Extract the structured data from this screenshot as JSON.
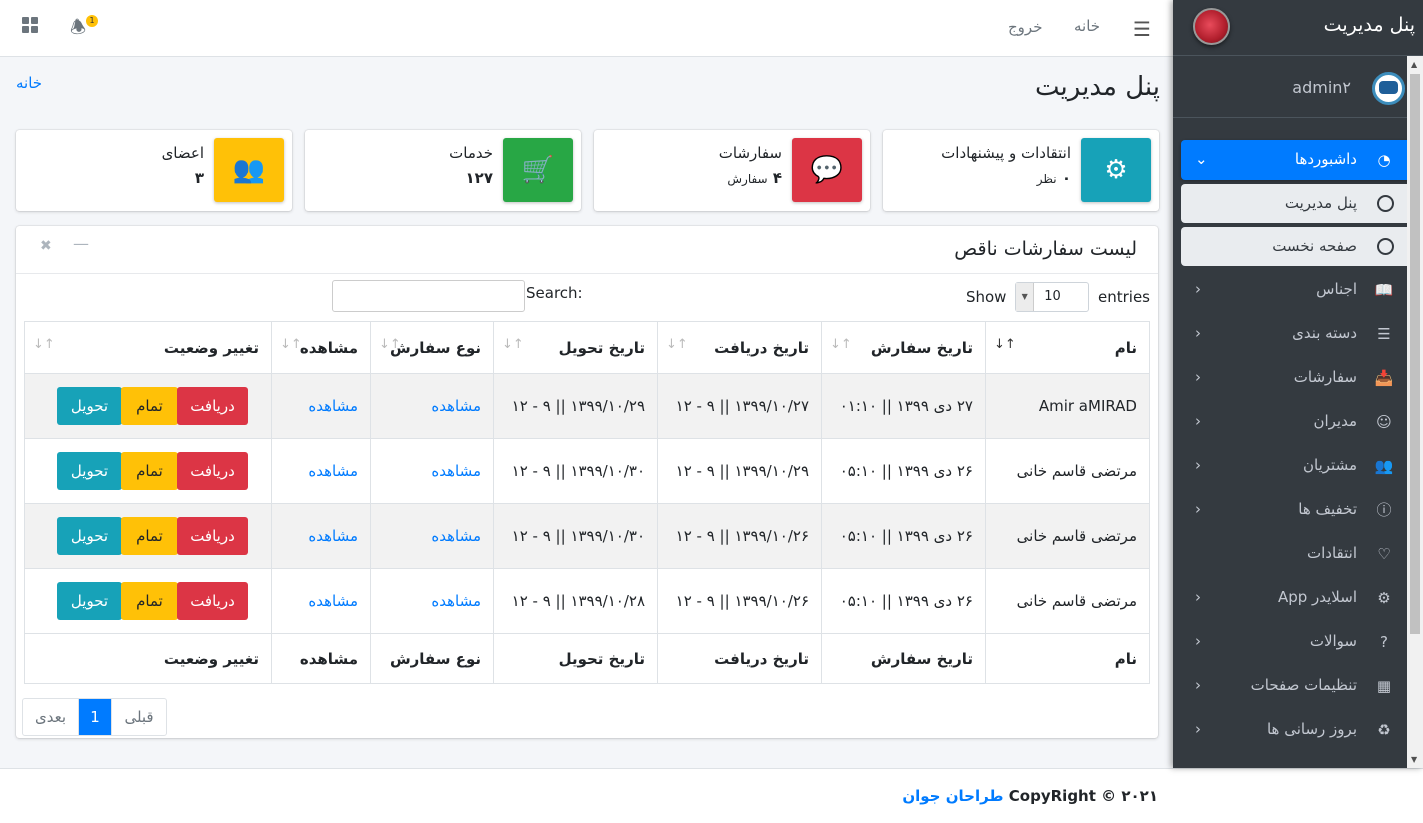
{
  "header": {
    "home": "خانه",
    "logout": "خروج",
    "notif_count": "1"
  },
  "sidebar": {
    "brand": "پنل مدیریت",
    "user": "admin۲",
    "items": [
      {
        "label": "داشبوردها",
        "icon": "dashboard-icon"
      },
      {
        "label": "اجناس",
        "icon": "book-icon"
      },
      {
        "label": "دسته بندی",
        "icon": "list-icon"
      },
      {
        "label": "سفارشات",
        "icon": "inbox-icon"
      },
      {
        "label": "مدیران",
        "icon": "user-circle-icon"
      },
      {
        "label": "مشتریان",
        "icon": "users-icon"
      },
      {
        "label": "تخفیف ها",
        "icon": "info-icon"
      },
      {
        "label": "انتقادات",
        "icon": "heart-icon"
      },
      {
        "label": "اسلایدر App",
        "icon": "sliders-icon"
      },
      {
        "label": "سوالات",
        "icon": "question-icon"
      },
      {
        "label": "تنظیمات صفحات",
        "icon": "settings-icon"
      },
      {
        "label": "بروز رسانی ها",
        "icon": "recycle-icon"
      }
    ],
    "subitems": [
      {
        "label": "پنل مدیریت"
      },
      {
        "label": "صفحه نخست"
      }
    ]
  },
  "page": {
    "breadcrumb": "خانه",
    "title": "پنل مدیریت"
  },
  "info_boxes": [
    {
      "title": "اعضای",
      "value": "۳",
      "sub": "",
      "color": "#ffc107",
      "icon": "users-icon"
    },
    {
      "title": "خدمات",
      "value": "۱۲۷",
      "sub": "",
      "color": "#28a745",
      "icon": "cart-icon"
    },
    {
      "title": "سفارشات",
      "value": "۴",
      "sub": "سفارش",
      "color": "#dc3545",
      "icon": "comment-icon"
    },
    {
      "title": "انتقادات و پیشنهادات",
      "value": "۰",
      "sub": "نظر",
      "color": "#17a2b8",
      "icon": "gear-icon"
    }
  ],
  "card": {
    "title": "لیست سفارشات ناقص",
    "show_label": "Show",
    "entries_label": "entries",
    "page_size": "10",
    "search_label": "Search:",
    "columns": [
      "نام",
      "تاریخ سفارش",
      "تاریخ دریافت",
      "تاریخ تحویل",
      "نوع سفارش",
      "مشاهده",
      "تغییر وضعیت"
    ],
    "rows": [
      {
        "name": "Amir aMIRAD",
        "order": "۲۷ دی ۱۳۹۹ || ۰۱:۱۰",
        "receive": "۱۳۹۹/۱۰/۲۷ || ۹ - ۱۲",
        "deliver": "۱۳۹۹/۱۰/۲۹ || ۹ - ۱۲",
        "type": "مشاهده",
        "view": "مشاهده"
      },
      {
        "name": "مرتضی قاسم خانی",
        "order": "۲۶ دی ۱۳۹۹ || ۰۵:۱۰",
        "receive": "۱۳۹۹/۱۰/۲۹ || ۹ - ۱۲",
        "deliver": "۱۳۹۹/۱۰/۳۰ || ۹ - ۱۲",
        "type": "مشاهده",
        "view": "مشاهده"
      },
      {
        "name": "مرتضی قاسم خانی",
        "order": "۲۶ دی ۱۳۹۹ || ۰۵:۱۰",
        "receive": "۱۳۹۹/۱۰/۲۶ || ۹ - ۱۲",
        "deliver": "۱۳۹۹/۱۰/۳۰ || ۹ - ۱۲",
        "type": "مشاهده",
        "view": "مشاهده"
      },
      {
        "name": "مرتضی قاسم خانی",
        "order": "۲۶ دی ۱۳۹۹ || ۰۵:۱۰",
        "receive": "۱۳۹۹/۱۰/۲۶ || ۹ - ۱۲",
        "deliver": "۱۳۹۹/۱۰/۲۸ || ۹ - ۱۲",
        "type": "مشاهده",
        "view": "مشاهده"
      }
    ],
    "buttons": {
      "receive": "دریافت",
      "done": "تمام",
      "deliver": "تحویل"
    },
    "pager": {
      "prev": "قبلی",
      "current": "1",
      "next": "بعدی"
    }
  },
  "footer": {
    "year": "۲۰۲۱ ©",
    "copyright": "CopyRight",
    "author": "طراحان جوان"
  }
}
